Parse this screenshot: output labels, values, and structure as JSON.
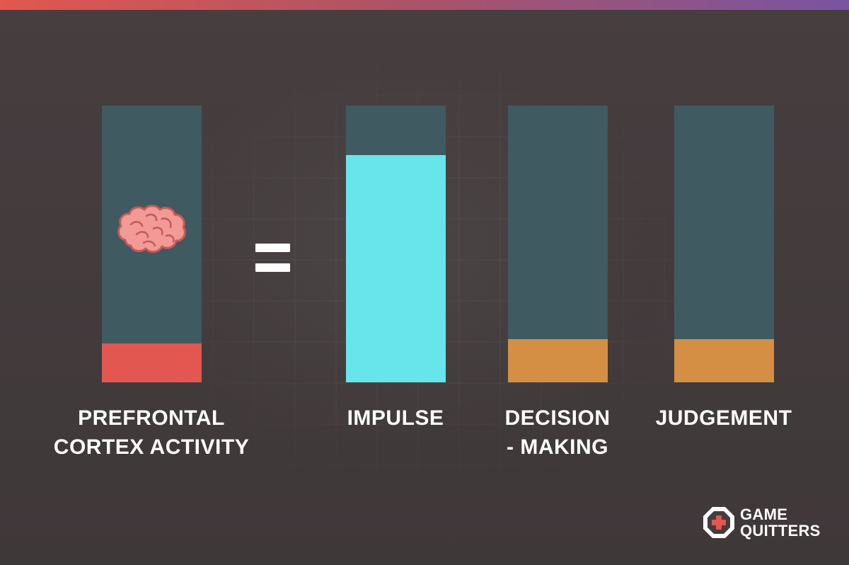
{
  "chart_data": {
    "type": "bar",
    "categories": [
      "PREFRONTAL\nCORTEX ACTIVITY",
      "IMPULSE",
      "DECISION\n- MAKING",
      "JUDGEMENT"
    ],
    "values": [
      14,
      82,
      15.5,
      15.5
    ],
    "ylim": [
      0,
      100
    ],
    "colors": [
      "#e2574f",
      "#67e5ea",
      "#d48f44",
      "#d48f44"
    ],
    "track_color": "#3f5a60",
    "separator": "=",
    "grid": false
  },
  "logo": {
    "text": "GAME\nQUITTERS",
    "icon": "gamepad-icon"
  },
  "decoration": {
    "icon": "brain-icon"
  },
  "colors": {
    "top_gradient": [
      "#e2574f",
      "#7a54a0"
    ],
    "background": "#443c3d"
  }
}
